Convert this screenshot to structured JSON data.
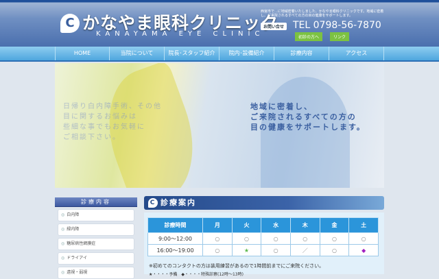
{
  "header": {
    "logo_glyph": "C",
    "title": "かなやま眼科クリニック",
    "subtitle": "KANAYAMA EYE CLINIC",
    "intro": "西宮市で...に地域密着いたしました、かなやま眼科クリニックです。地域に密着し、ご来院されるすべての方の目の健康をサポートします。",
    "contact_badge": "お問い合せ",
    "tel": "TEL 0798-56-7870",
    "buttons": [
      "初診の方へ",
      "リンク"
    ]
  },
  "nav": [
    "HOME",
    "当院について",
    "院長･スタッフ紹介",
    "院内･設備紹介",
    "診療内容",
    "アクセス"
  ],
  "hero": {
    "left_lines": [
      "日帰り白内障手術、その他",
      "目に関するお悩みは",
      "些細な事でもお気軽に",
      "ご相談下さい。"
    ],
    "right_lines": [
      "地域に密着し、",
      "ご来院されるすべての方の",
      "目の健康をサポートします。"
    ]
  },
  "sidebar": {
    "title": "診療内容",
    "items": [
      "白内障",
      "緑内障",
      "糖尿病性網膜症",
      "ドライアイ",
      "遠視・弱視"
    ]
  },
  "main": {
    "title": "診療案内",
    "table": {
      "headers": [
        "診療時間",
        "月",
        "火",
        "水",
        "木",
        "金",
        "土"
      ],
      "rows": [
        [
          "9:00〜12:00",
          "○",
          "○",
          "○",
          "○",
          "○",
          "○"
        ],
        [
          "16:00〜19:00",
          "○",
          "★",
          "○",
          "／",
          "○",
          "◆"
        ]
      ]
    },
    "note": "※初めてのコンタクトの方は装用練習があるので1時間前までにご来院ください。",
    "legend": "★・・・・予備　◆・・・・特殊診察(12時〜13時)",
    "colors": {
      "star": "#5bb84a",
      "diamond": "#a020c0"
    }
  }
}
